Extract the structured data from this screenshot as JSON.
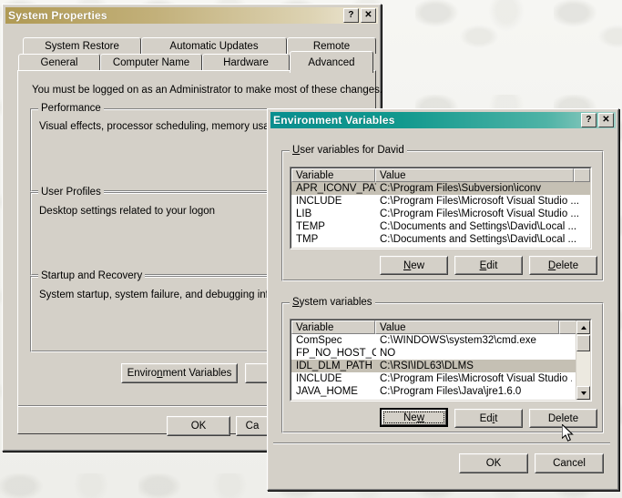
{
  "system_properties": {
    "title": "System Properties",
    "titlebar_buttons": [
      {
        "name": "help-button",
        "glyph": "?"
      },
      {
        "name": "close-button",
        "glyph": "✕"
      }
    ],
    "tabs_row1": [
      {
        "label": "System Restore",
        "selected": false
      },
      {
        "label": "Automatic Updates",
        "selected": false
      },
      {
        "label": "Remote",
        "selected": false
      }
    ],
    "tabs_row2": [
      {
        "label": "General",
        "selected": false
      },
      {
        "label": "Computer Name",
        "selected": false
      },
      {
        "label": "Hardware",
        "selected": false
      },
      {
        "label": "Advanced",
        "selected": true
      }
    ],
    "admin_notice": "You must be logged on as an Administrator to make most of these changes.",
    "groups": [
      {
        "label": "Performance",
        "text": "Visual effects, processor scheduling, memory usage, a"
      },
      {
        "label": "User Profiles",
        "text": "Desktop settings related to your logon"
      },
      {
        "label": "Startup and Recovery",
        "text": "System startup, system failure, and debugging informat"
      }
    ],
    "buttons": {
      "environment_variables": "Environment Variables",
      "ok": "OK",
      "cancel": "Ca"
    }
  },
  "environment_variables": {
    "title": "Environment Variables",
    "titlebar_buttons": [
      {
        "name": "help-button",
        "glyph": "?"
      },
      {
        "name": "close-button",
        "glyph": "✕"
      }
    ],
    "user_section": {
      "label": "User variables for David",
      "columns": [
        "Variable",
        "Value"
      ],
      "rows": [
        {
          "variable": "APR_ICONV_PATH",
          "value": "C:\\Program Files\\Subversion\\iconv",
          "selected": true
        },
        {
          "variable": "INCLUDE",
          "value": "C:\\Program Files\\Microsoft Visual Studio ...",
          "selected": false
        },
        {
          "variable": "LIB",
          "value": "C:\\Program Files\\Microsoft Visual Studio ...",
          "selected": false
        },
        {
          "variable": "TEMP",
          "value": "C:\\Documents and Settings\\David\\Local ...",
          "selected": false
        },
        {
          "variable": "TMP",
          "value": "C:\\Documents and Settings\\David\\Local ...",
          "selected": false
        }
      ],
      "buttons": {
        "new": "New",
        "edit": "Edit",
        "delete": "Delete"
      }
    },
    "system_section": {
      "label": "System variables",
      "columns": [
        "Variable",
        "Value"
      ],
      "rows": [
        {
          "variable": "ComSpec",
          "value": "C:\\WINDOWS\\system32\\cmd.exe",
          "selected": false
        },
        {
          "variable": "FP_NO_HOST_C...",
          "value": "NO",
          "selected": false
        },
        {
          "variable": "IDL_DLM_PATH",
          "value": "C:\\RSI\\IDL63\\DLMS",
          "selected": true
        },
        {
          "variable": "INCLUDE",
          "value": "C:\\Program Files\\Microsoft Visual Studio ...",
          "selected": false
        },
        {
          "variable": "JAVA_HOME",
          "value": "C:\\Program Files\\Java\\jre1.6.0",
          "selected": false
        }
      ],
      "buttons": {
        "new": "New",
        "edit": "Edit",
        "delete": "Delete"
      },
      "scrollbar": {
        "up_icon": "scroll-up-arrow",
        "down_icon": "scroll-down-arrow"
      }
    },
    "footer_buttons": {
      "ok": "OK",
      "cancel": "Cancel"
    }
  }
}
